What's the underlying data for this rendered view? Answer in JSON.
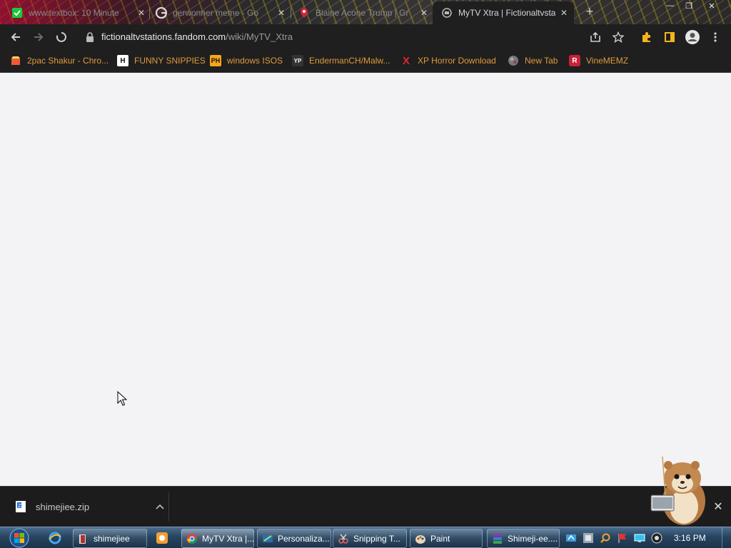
{
  "tabs": [
    {
      "title": "www.textbox: 10 Minute",
      "icon": "checkmark-green-icon",
      "active": false
    },
    {
      "title": "gerwonner meme - Go",
      "icon": "google-icon",
      "active": false
    },
    {
      "title": "Blaine Acone Trump | Gr",
      "icon": "map-pin-red-icon",
      "active": false
    },
    {
      "title": "MyTV Xtra | Fictionaltvsta",
      "icon": "fandom-icon",
      "active": true
    }
  ],
  "omnibox": {
    "domain": "fictionaltvstations.fandom.com",
    "path": "/wiki/MyTV_Xtra"
  },
  "bookmarks": [
    {
      "label": "2pac Shakur - Chro...",
      "icon": "chrome-store-icon"
    },
    {
      "label": "FUNNY SNIPPIES",
      "icon": "h-letter-icon",
      "icon_text": "H"
    },
    {
      "label": "windows ISOS",
      "icon": "ph-letter-icon",
      "icon_text": "PH"
    },
    {
      "label": "EndermanCH/Malw...",
      "icon": "yp-letter-icon",
      "icon_text": "YP"
    },
    {
      "label": "XP Horror Download",
      "icon": "red-x-icon",
      "icon_text": "X"
    },
    {
      "label": "New Tab",
      "icon": "globe-icon"
    },
    {
      "label": "VineMEMZ",
      "icon": "r-letter-icon",
      "icon_text": "R"
    }
  ],
  "download": {
    "filename": "shimejiee.zip"
  },
  "taskbar": {
    "buttons": [
      {
        "label": "shimejiee",
        "icon": "folder-icon",
        "active": false
      },
      {
        "label": "MyTV Xtra |...",
        "icon": "chrome-icon",
        "active": true
      },
      {
        "label": "Personaliza...",
        "icon": "personalization-icon",
        "active": false
      },
      {
        "label": "Snipping T...",
        "icon": "snipping-tool-icon",
        "active": false
      },
      {
        "label": "Paint",
        "icon": "paint-icon",
        "active": false
      },
      {
        "label": "Shimeji-ee....",
        "icon": "winrar-icon",
        "active": false
      }
    ],
    "clock": "3:16 PM"
  },
  "colors": {
    "chrome_dark": "#1f1f1f",
    "bookmark_text": "#e09a3a",
    "page_background": "#f3f2f5"
  }
}
